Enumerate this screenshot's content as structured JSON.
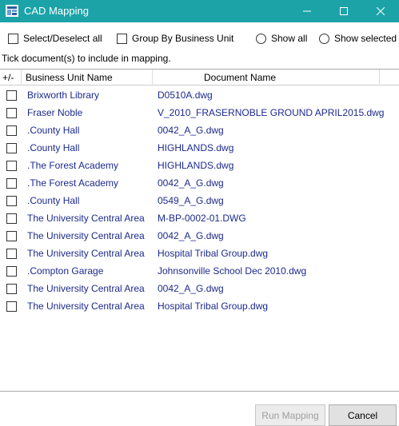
{
  "window": {
    "title": "CAD Mapping",
    "minimize_glyph": "—",
    "maximize_glyph": "☐",
    "close_glyph": "✕",
    "titlebar_color": "#1ba3a8"
  },
  "options": {
    "select_all_label": "Select/Deselect all",
    "group_by_label": "Group By Business Unit",
    "show_all_label": "Show all",
    "show_selected_label": "Show selected"
  },
  "hint": "Tick document(s) to include in mapping.",
  "grid": {
    "col_toggle": "+/-",
    "col_business_unit": "Business Unit Name",
    "col_document": "Document Name",
    "rows": [
      {
        "bu": "Brixworth Library",
        "doc": "D0510A.dwg"
      },
      {
        "bu": "Fraser Noble",
        "doc": "V_2010_FRASERNOBLE GROUND APRIL2015.dwg"
      },
      {
        "bu": ".County Hall",
        "doc": "0042_A_G.dwg"
      },
      {
        "bu": ".County Hall",
        "doc": "HIGHLANDS.dwg"
      },
      {
        "bu": ".The Forest Academy",
        "doc": "HIGHLANDS.dwg"
      },
      {
        "bu": ".The Forest Academy",
        "doc": "0042_A_G.dwg"
      },
      {
        "bu": ".County Hall",
        "doc": "0549_A_G.dwg"
      },
      {
        "bu": "The University Central Area",
        "doc": "M-BP-0002-01.DWG"
      },
      {
        "bu": "The University Central Area",
        "doc": "0042_A_G.dwg"
      },
      {
        "bu": "The University Central Area",
        "doc": "Hospital Tribal Group.dwg"
      },
      {
        "bu": ".Compton Garage",
        "doc": "Johnsonville School Dec 2010.dwg"
      },
      {
        "bu": "The University Central Area",
        "doc": "0042_A_G.dwg"
      },
      {
        "bu": "The University Central Area",
        "doc": "Hospital Tribal Group.dwg"
      }
    ]
  },
  "buttons": {
    "run_label": "Run Mapping",
    "cancel_label": "Cancel"
  }
}
